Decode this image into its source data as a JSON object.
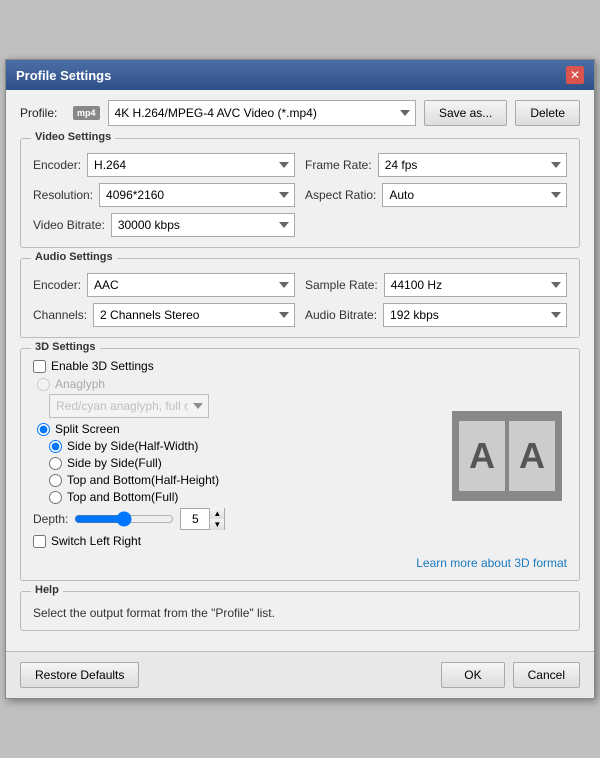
{
  "titleBar": {
    "title": "Profile Settings",
    "closeLabel": "✕"
  },
  "profileRow": {
    "label": "Profile:",
    "iconText": "mp4",
    "profileValue": "4K H.264/MPEG-4 AVC Video (*.mp4)",
    "saveAsLabel": "Save as...",
    "deleteLabel": "Delete"
  },
  "videoSettings": {
    "sectionTitle": "Video Settings",
    "encoderLabel": "Encoder:",
    "encoderValue": "H.264",
    "frameRateLabel": "Frame Rate:",
    "frameRateValue": "24 fps",
    "resolutionLabel": "Resolution:",
    "resolutionValue": "4096*2160",
    "aspectRatioLabel": "Aspect Ratio:",
    "aspectRatioValue": "Auto",
    "videoBitrateLabel": "Video Bitrate:",
    "videoBitrateValue": "30000 kbps"
  },
  "audioSettings": {
    "sectionTitle": "Audio Settings",
    "encoderLabel": "Encoder:",
    "encoderValue": "AAC",
    "sampleRateLabel": "Sample Rate:",
    "sampleRateValue": "44100 Hz",
    "channelsLabel": "Channels:",
    "channelsValue": "2 Channels Stereo",
    "audioBitrateLabel": "Audio Bitrate:",
    "audioBitrateValue": "192 kbps"
  },
  "threeDSettings": {
    "sectionTitle": "3D Settings",
    "enableLabel": "Enable 3D Settings",
    "anaglyphLabel": "Anaglyph",
    "anaglyphDropdown": "Red/cyan anaglyph, full color",
    "splitScreenLabel": "Split Screen",
    "option1": "Side by Side(Half-Width)",
    "option2": "Side by Side(Full)",
    "option3": "Top and Bottom(Half-Height)",
    "option4": "Top and Bottom(Full)",
    "depthLabel": "Depth:",
    "depthValue": "5",
    "switchLabel": "Switch Left Right",
    "previewLetters": [
      "A",
      "A"
    ],
    "learnLink": "Learn more about 3D format"
  },
  "help": {
    "sectionTitle": "Help",
    "helpText": "Select the output format from the \"Profile\" list."
  },
  "footer": {
    "restoreLabel": "Restore Defaults",
    "okLabel": "OK",
    "cancelLabel": "Cancel"
  }
}
